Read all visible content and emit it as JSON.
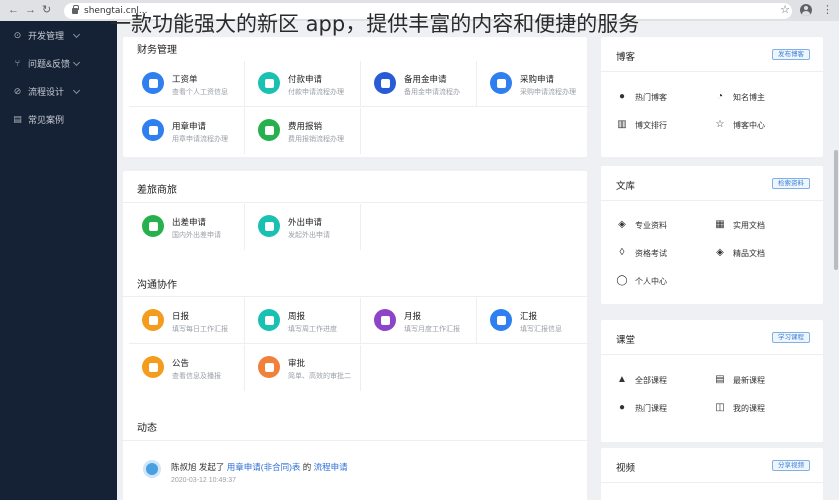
{
  "browser": {
    "url": "shengtai.cnl...",
    "back_glyph": "←",
    "forward_glyph": "→",
    "reload_glyph": "↻",
    "star_glyph": "☆",
    "menu_glyph": "⋮"
  },
  "headline": "一款功能强大的新区 app，提供丰富的内容和便捷的服务",
  "sidebar": {
    "items": [
      {
        "label": "开发管理",
        "icon": "⊙"
      },
      {
        "label": "问题&反馈",
        "icon": "⑂"
      },
      {
        "label": "流程设计",
        "icon": "⊘"
      },
      {
        "label": "常见案例",
        "icon": "▤"
      }
    ]
  },
  "finance": {
    "title": "财务管理",
    "items": [
      {
        "name": "工资单",
        "desc": "查看个人工资信息",
        "color": "#2f7ff0"
      },
      {
        "name": "付款申请",
        "desc": "付款申请流程办理",
        "color": "#19c1b3"
      },
      {
        "name": "备用金申请",
        "desc": "备用金申请流程办",
        "color": "#2a5bd7"
      },
      {
        "name": "采购申请",
        "desc": "采购申请流程办理",
        "color": "#2f7ff0"
      },
      {
        "name": "用章申请",
        "desc": "用章申请流程办理",
        "color": "#2f7ff0"
      },
      {
        "name": "费用报销",
        "desc": "费用报销流程办理",
        "color": "#27b14e"
      }
    ]
  },
  "travel": {
    "title": "差旅商旅",
    "items": [
      {
        "name": "出差申请",
        "desc": "国内外出差申请",
        "color": "#27b14e"
      },
      {
        "name": "外出申请",
        "desc": "发起外出申请",
        "color": "#19c1b3"
      }
    ]
  },
  "collab": {
    "title": "沟通协作",
    "items": [
      {
        "name": "日报",
        "desc": "填写每日工作汇报",
        "color": "#f39c1e"
      },
      {
        "name": "周报",
        "desc": "填写周工作进度",
        "color": "#19c1b3"
      },
      {
        "name": "月报",
        "desc": "填写月度工作汇报",
        "color": "#8e44c9"
      },
      {
        "name": "汇报",
        "desc": "填写汇报信息",
        "color": "#2f7ff0"
      },
      {
        "name": "公告",
        "desc": "查看信息及播报",
        "color": "#f39c1e"
      },
      {
        "name": "审批",
        "desc": "简单、高效的审批二",
        "color": "#f0803a"
      }
    ]
  },
  "feed": {
    "title": "动态",
    "user": "陈叔旭",
    "verb": " 发起了 ",
    "target": "用章申请(非合同)表",
    "mid": " 的 ",
    "link": "流程申请",
    "time": "2020-03-12 10:49:37"
  },
  "blog": {
    "title": "博客",
    "badge": "发布博客",
    "items": [
      {
        "label": "热门博客",
        "icon": "flame-icon",
        "glyph": "●"
      },
      {
        "label": "知名博主",
        "icon": "signal-icon",
        "glyph": "◔"
      },
      {
        "label": "博文排行",
        "icon": "bar-chart-icon",
        "glyph": "▥"
      },
      {
        "label": "博客中心",
        "icon": "star-icon",
        "glyph": "☆"
      }
    ]
  },
  "library": {
    "title": "文库",
    "badge": "检索资料",
    "items": [
      {
        "label": "专业资料",
        "icon": "layers-icon",
        "glyph": "◈"
      },
      {
        "label": "实用文档",
        "icon": "books-icon",
        "glyph": "▦"
      },
      {
        "label": "资格考试",
        "icon": "leaf-icon",
        "glyph": "◊"
      },
      {
        "label": "精品文档",
        "icon": "layers-icon",
        "glyph": "◈"
      },
      {
        "label": "个人中心",
        "icon": "user-icon",
        "glyph": "◯"
      }
    ]
  },
  "course": {
    "title": "课堂",
    "badge": "学习课程",
    "items": [
      {
        "label": "全部课程",
        "icon": "mortarboard-icon",
        "glyph": "▲"
      },
      {
        "label": "最新课程",
        "icon": "document-icon",
        "glyph": "▤"
      },
      {
        "label": "热门课程",
        "icon": "flame-icon",
        "glyph": "●"
      },
      {
        "label": "我的课程",
        "icon": "book-icon",
        "glyph": "◫"
      }
    ]
  },
  "video": {
    "title": "视频",
    "badge": "分享视频"
  }
}
